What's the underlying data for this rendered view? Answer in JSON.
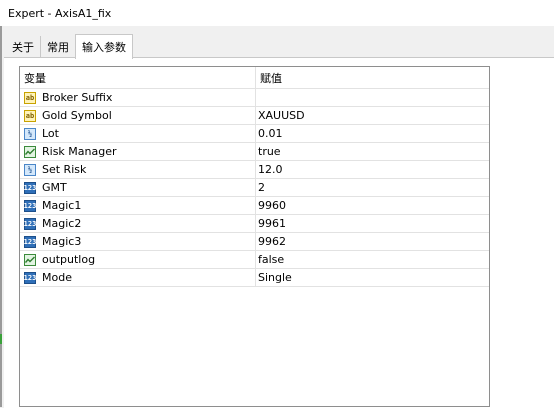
{
  "window": {
    "title": "Expert - AxisA1_fix"
  },
  "tabs": [
    {
      "label": "关于"
    },
    {
      "label": "常用"
    },
    {
      "label": "输入参数"
    }
  ],
  "table": {
    "headers": {
      "variable": "变量",
      "value": "赋值"
    },
    "rows": [
      {
        "icon": "string-icon",
        "variable": "Broker Suffix",
        "value": ""
      },
      {
        "icon": "string-icon",
        "variable": "Gold Symbol",
        "value": "XAUUSD"
      },
      {
        "icon": "double-icon",
        "variable": "Lot",
        "value": "0.01"
      },
      {
        "icon": "bool-icon",
        "variable": "Risk Manager",
        "value": "true"
      },
      {
        "icon": "double-icon",
        "variable": "Set Risk",
        "value": "12.0"
      },
      {
        "icon": "int-icon",
        "variable": "GMT",
        "value": "2"
      },
      {
        "icon": "int-icon",
        "variable": "Magic1",
        "value": "9960"
      },
      {
        "icon": "int-icon",
        "variable": "Magic2",
        "value": "9961"
      },
      {
        "icon": "int-icon",
        "variable": "Magic3",
        "value": "9962"
      },
      {
        "icon": "bool-icon",
        "variable": "outputlog",
        "value": "false"
      },
      {
        "icon": "int-icon",
        "variable": "Mode",
        "value": "Single"
      }
    ]
  }
}
